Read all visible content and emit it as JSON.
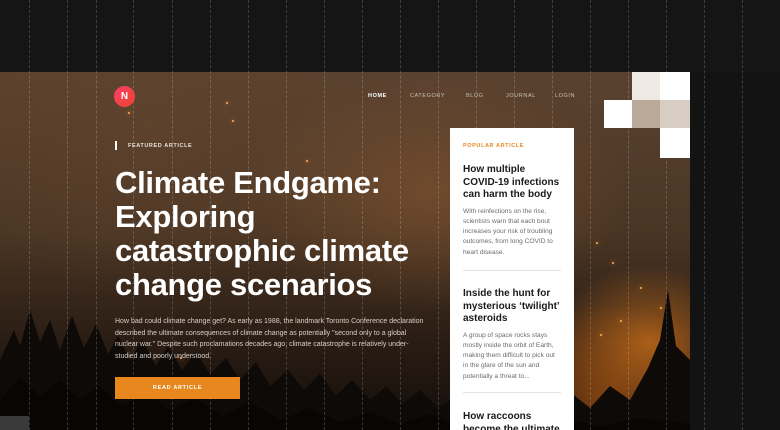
{
  "brand": {
    "logo_letter": "N",
    "accent": "#e8871e",
    "logo_gradient": [
      "#ff3d6e",
      "#e8462a"
    ]
  },
  "nav": {
    "items": [
      {
        "label": "HOME",
        "active": true
      },
      {
        "label": "CATEGORY",
        "active": false
      },
      {
        "label": "BLOG",
        "active": false
      },
      {
        "label": "JOURNAL",
        "active": false
      },
      {
        "label": "LOGIN",
        "active": false
      }
    ]
  },
  "featured": {
    "label": "FEATURED ARTICLE",
    "title": "Climate Endgame: Exploring catastrophic climate change scenarios",
    "summary": "How bad could climate change get? As early as 1988, the landmark Toronto Conference declaration described the ultimate consequences of climate change as potentially \"second only to a global nuclear war.\" Despite such proclamations decades ago, climate catastrophe is relatively under-studied and poorly understood.",
    "button_label": "READ ARTICLE"
  },
  "popular": {
    "label": "POPULAR ARTICLE",
    "items": [
      {
        "title": "How multiple COVID-19 infections can harm the body",
        "excerpt": "With reinfections on the rise, scientists warn that each bout increases your risk of troubling outcomes, from long COVID to heart disease."
      },
      {
        "title": "Inside the hunt for mysterious ‘twilight’ asteroids",
        "excerpt": "A group of space rocks stays mostly inside the orbit of Earth, making them difficult to pick out in the glare of the sun and potentially a threat to..."
      },
      {
        "title": "How raccoons become the ultimate",
        "excerpt": ""
      }
    ]
  }
}
